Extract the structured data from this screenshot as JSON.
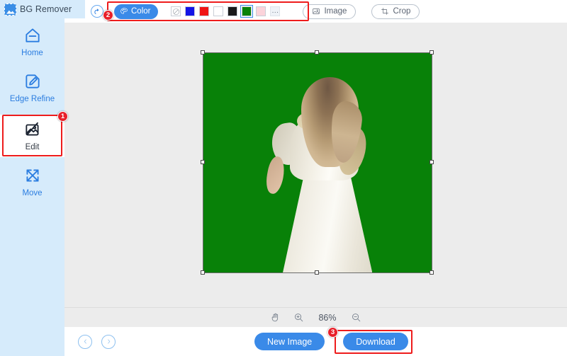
{
  "app": {
    "brand": "BG Remover",
    "logo_icon": "image-badge-icon"
  },
  "sidebar": {
    "items": [
      {
        "label": "Home",
        "icon": "home-icon",
        "active": false
      },
      {
        "label": "Edge Refine",
        "icon": "pencil-square-icon",
        "active": false
      },
      {
        "label": "Edit",
        "icon": "image-edit-icon",
        "active": true
      },
      {
        "label": "Move",
        "icon": "move-arrows-icon",
        "active": false
      }
    ]
  },
  "toolbar": {
    "undo_icon": "undo-arrow-icon",
    "redo_icon": "redo-arrow-icon",
    "color_label": "Color",
    "color_icon": "palette-icon",
    "swatches": [
      {
        "name": "transparent",
        "hex": "",
        "selected": false,
        "icon": "no-color-icon"
      },
      {
        "name": "blue",
        "hex": "#1414e6",
        "selected": false
      },
      {
        "name": "red",
        "hex": "#f01414",
        "selected": false
      },
      {
        "name": "white",
        "hex": "#ffffff",
        "selected": false
      },
      {
        "name": "black",
        "hex": "#1a1a1a",
        "selected": false
      },
      {
        "name": "green",
        "hex": "#088108",
        "selected": true
      },
      {
        "name": "pink",
        "hex": "#fbd3da",
        "selected": false
      },
      {
        "name": "more",
        "hex": "",
        "selected": false,
        "label": "..."
      }
    ],
    "image_label": "Image",
    "image_icon": "picture-icon",
    "crop_label": "Crop",
    "crop_icon": "crop-icon"
  },
  "canvas": {
    "background_color": "#ececec",
    "image_background_color": "#088108",
    "subject": "woman in cream dress seen from behind with long blonde wavy hair"
  },
  "zoombar": {
    "hand_icon": "hand-pan-icon",
    "zoom_in_icon": "zoom-in-icon",
    "zoom_level": "86%",
    "zoom_out_icon": "zoom-out-icon"
  },
  "bottombar": {
    "prev_icon": "chevron-left-icon",
    "next_icon": "chevron-right-icon",
    "new_image_label": "New Image",
    "download_label": "Download"
  },
  "annotations": {
    "accent_color": "#ee1c1c",
    "badges": [
      {
        "number": "1",
        "target": "sidebar-item-edit"
      },
      {
        "number": "2",
        "target": "toolbar-color-group"
      },
      {
        "number": "3",
        "target": "download-button"
      }
    ]
  }
}
